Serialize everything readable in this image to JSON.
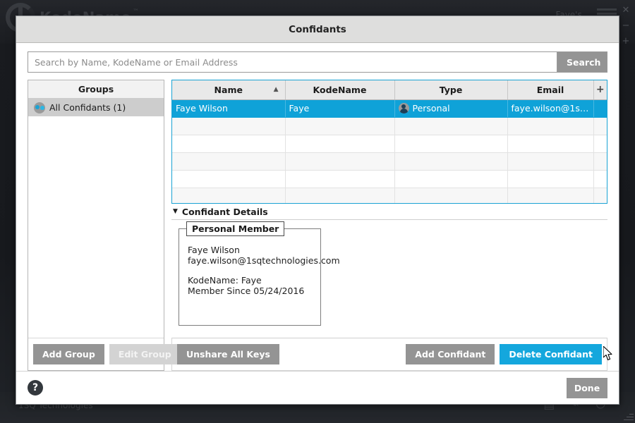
{
  "background": {
    "logo_text": "KodeName",
    "logo_tm": "™",
    "user_label": "Faye's ...",
    "footer_text": "1SQ Technologies",
    "window_controls": {
      "close": "✕",
      "minimize": "−",
      "plus": "+"
    },
    "footer_icons": [
      "list-icon",
      "key-icon",
      "power-icon"
    ]
  },
  "dialog": {
    "title": "Confidants",
    "search": {
      "placeholder": "Search by Name, KodeName or Email Address",
      "value": "",
      "button_label": "Search"
    },
    "groups": {
      "header": "Groups",
      "items": [
        {
          "label": "All Confidants (1)",
          "icon": "group-icon",
          "selected": true
        }
      ],
      "buttons": [
        {
          "label": "Add Group",
          "state": "enabled"
        },
        {
          "label": "Edit Group",
          "state": "disabled"
        }
      ]
    },
    "table": {
      "columns": [
        {
          "label": "Name",
          "sorted": "asc",
          "sort_indicator": "▲"
        },
        {
          "label": "KodeName",
          "sorted": "none",
          "sort_indicator": ""
        },
        {
          "label": "Type",
          "sorted": "none",
          "sort_indicator": ""
        },
        {
          "label": "Email",
          "sorted": "none",
          "sort_indicator": ""
        }
      ],
      "add_column_label": "+",
      "rows": [
        {
          "name": "Faye Wilson",
          "kodename": "Faye",
          "type": "Personal",
          "type_icon": "person-icon",
          "email": "faye.wilson@1sqtechnolo...",
          "selected": true
        }
      ],
      "empty_row_count": 6
    },
    "details": {
      "section_label": "Confidant Details",
      "collapse_indicator": "▼",
      "legend": "Personal Member",
      "name": "Faye Wilson",
      "email": "faye.wilson@1sqtechnologies.com",
      "kodename_line": "KodeName: Faye",
      "member_since_line": "Member Since 05/24/2016"
    },
    "action_buttons": {
      "unshare": {
        "label": "Unshare All Keys",
        "state": "enabled"
      },
      "add_confidant": {
        "label": "Add Confidant",
        "state": "enabled"
      },
      "delete_confidant": {
        "label": "Delete Confidant",
        "state": "hovered"
      }
    },
    "footer": {
      "help_label": "?",
      "done_label": "Done"
    },
    "colors": {
      "accent": "#14a7dd",
      "selection": "#0fa2d8",
      "button_gray": "#949494",
      "titlebar": "#dededd"
    }
  }
}
